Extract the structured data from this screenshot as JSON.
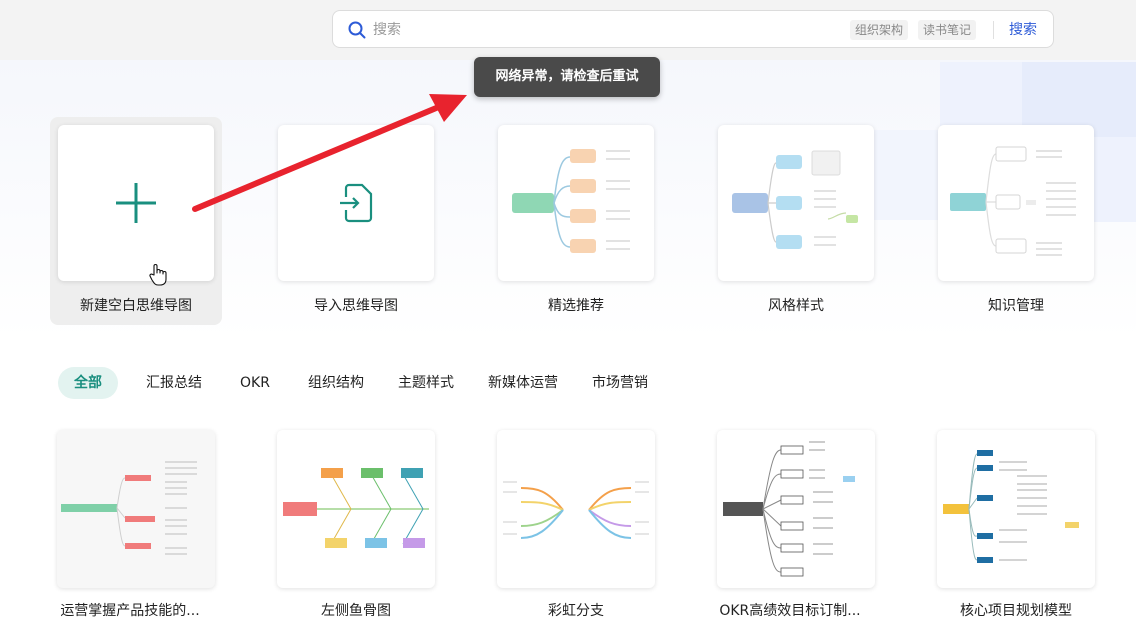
{
  "search": {
    "placeholder": "搜索",
    "tags": [
      "组织架构",
      "读书笔记"
    ],
    "button_label": "搜索"
  },
  "toast": {
    "message": "网络异常，请检查后重试"
  },
  "create_cards": [
    {
      "label": "新建空白思维导图"
    },
    {
      "label": "导入思维导图"
    },
    {
      "label": "精选推荐"
    },
    {
      "label": "风格样式"
    },
    {
      "label": "知识管理"
    }
  ],
  "category_tabs": [
    "全部",
    "汇报总结",
    "OKR",
    "组织结构",
    "主题样式",
    "新媒体运营",
    "市场营销"
  ],
  "active_tab": "全部",
  "templates": [
    {
      "label": "运营掌握产品技能的..."
    },
    {
      "label": "左侧鱼骨图"
    },
    {
      "label": "彩虹分支"
    },
    {
      "label": "OKR高绩效目标订制..."
    },
    {
      "label": "核心项目规划模型"
    }
  ],
  "colors": {
    "accent": "#1a8f7f",
    "link": "#2d5bd7",
    "arrow": "#e8232e"
  }
}
